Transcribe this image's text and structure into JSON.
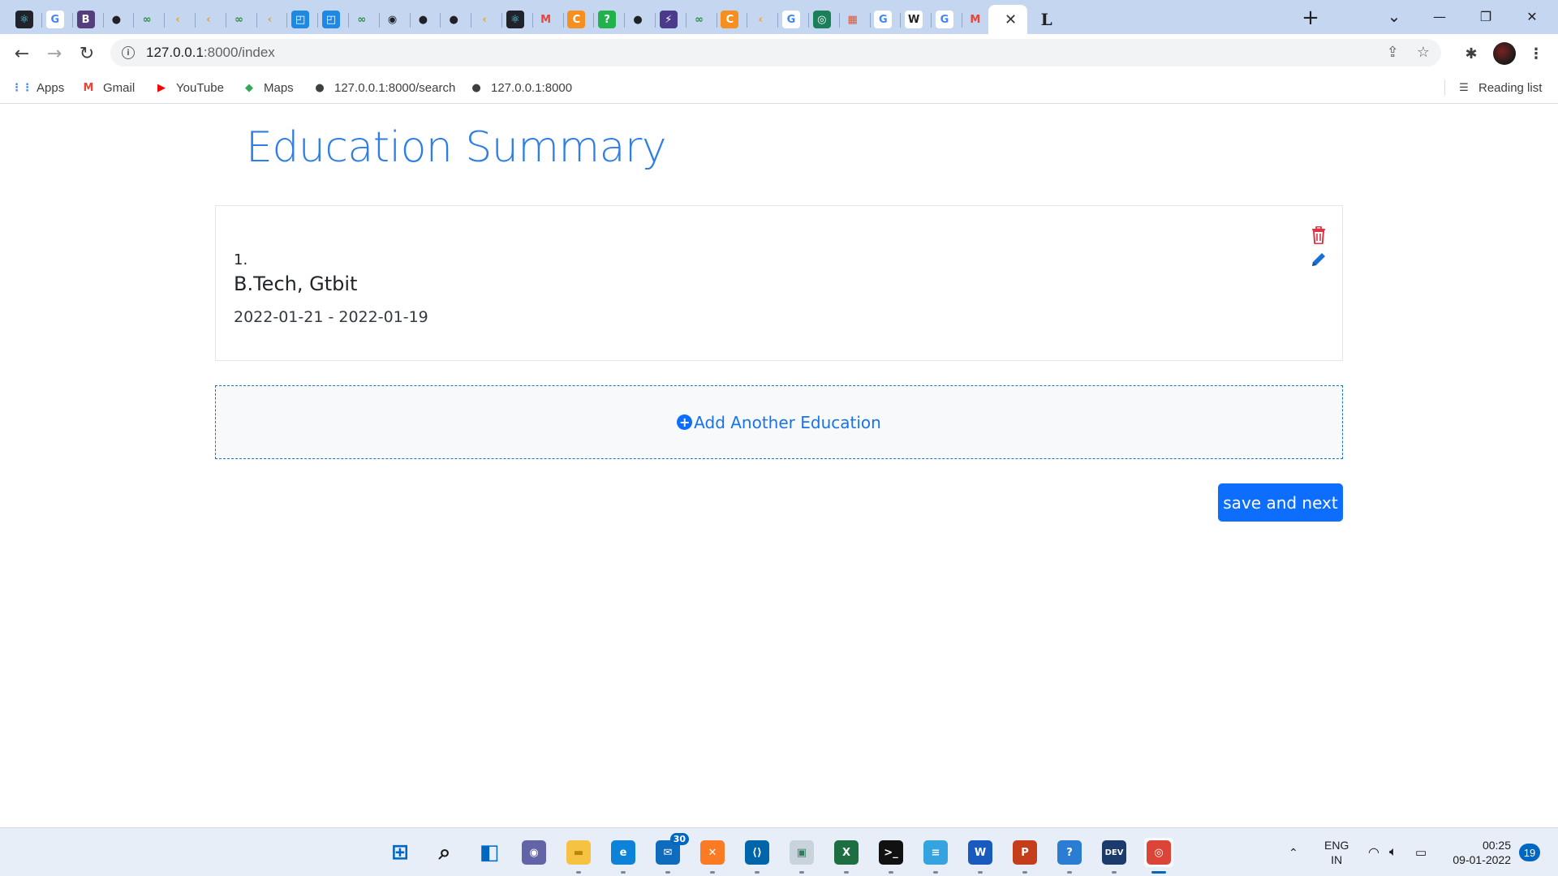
{
  "browser": {
    "tabs": [
      {
        "icon": "react-icon",
        "glyph": "⚛",
        "color": "#61dafb",
        "bg": "#20232a"
      },
      {
        "icon": "google-icon",
        "glyph": "G",
        "color": "#4285f4",
        "bg": "#ffffff"
      },
      {
        "icon": "bootstrap-icon",
        "glyph": "B",
        "color": "#ffffff",
        "bg": "#563d7c"
      },
      {
        "icon": "globe-icon",
        "glyph": "●",
        "color": "#202124",
        "bg": "#c5d6f0"
      },
      {
        "icon": "geeksforgeeks-icon",
        "glyph": "∞",
        "color": "#2f8d46",
        "bg": "#c5d6f0"
      },
      {
        "icon": "codepen-icon",
        "glyph": "‹",
        "color": "#f0a01a",
        "bg": "#c5d6f0"
      },
      {
        "icon": "codepen-icon",
        "glyph": "‹",
        "color": "#f0a01a",
        "bg": "#c5d6f0"
      },
      {
        "icon": "geeksforgeeks-icon",
        "glyph": "∞",
        "color": "#2f8d46",
        "bg": "#c5d6f0"
      },
      {
        "icon": "codepen-icon",
        "glyph": "‹",
        "color": "#f0a01a",
        "bg": "#c5d6f0"
      },
      {
        "icon": "vscode-doc-icon",
        "glyph": "◰",
        "color": "#ffffff",
        "bg": "#1e88e5"
      },
      {
        "icon": "vscode-doc-icon",
        "glyph": "◰",
        "color": "#ffffff",
        "bg": "#1e88e5"
      },
      {
        "icon": "geeksforgeeks-icon",
        "glyph": "∞",
        "color": "#2f8d46",
        "bg": "#c5d6f0"
      },
      {
        "icon": "github-icon",
        "glyph": "◉",
        "color": "#202124",
        "bg": "#c5d6f0"
      },
      {
        "icon": "globe-icon",
        "glyph": "●",
        "color": "#202124",
        "bg": "#c5d6f0"
      },
      {
        "icon": "globe-icon",
        "glyph": "●",
        "color": "#202124",
        "bg": "#c5d6f0"
      },
      {
        "icon": "codepen-icon",
        "glyph": "‹",
        "color": "#f0a01a",
        "bg": "#c5d6f0"
      },
      {
        "icon": "react-icon",
        "glyph": "⚛",
        "color": "#61dafb",
        "bg": "#20232a"
      },
      {
        "icon": "gmail-icon",
        "glyph": "M",
        "color": "#ea4335",
        "bg": "#c5d6f0"
      },
      {
        "icon": "codechef-icon",
        "glyph": "C",
        "color": "#ffffff",
        "bg": "#f78f1e"
      },
      {
        "icon": "question-green-icon",
        "glyph": "?",
        "color": "#ffffff",
        "bg": "#21b24b"
      },
      {
        "icon": "globe-icon",
        "glyph": "●",
        "color": "#202124",
        "bg": "#c5d6f0"
      },
      {
        "icon": "bolt-icon",
        "glyph": "⚡",
        "color": "#ffffff",
        "bg": "#4b3a8c"
      },
      {
        "icon": "geeksforgeeks-icon",
        "glyph": "∞",
        "color": "#2f8d46",
        "bg": "#c5d6f0"
      },
      {
        "icon": "codechef-icon",
        "glyph": "C",
        "color": "#ffffff",
        "bg": "#f78f1e"
      },
      {
        "icon": "codepen-icon",
        "glyph": "‹",
        "color": "#f0a01a",
        "bg": "#c5d6f0"
      },
      {
        "icon": "google-icon",
        "glyph": "G",
        "color": "#4285f4",
        "bg": "#ffffff"
      },
      {
        "icon": "app-green-icon",
        "glyph": "◎",
        "color": "#ffffff",
        "bg": "#1b7f5a"
      },
      {
        "icon": "microsoft-icon",
        "glyph": "▦",
        "color": "#f25022",
        "bg": "#c5d6f0"
      },
      {
        "icon": "google-icon",
        "glyph": "G",
        "color": "#4285f4",
        "bg": "#ffffff"
      },
      {
        "icon": "wikipedia-icon",
        "glyph": "W",
        "color": "#202124",
        "bg": "#ffffff"
      },
      {
        "icon": "google-icon",
        "glyph": "G",
        "color": "#4285f4",
        "bg": "#ffffff"
      },
      {
        "icon": "gmail-icon",
        "glyph": "M",
        "color": "#ea4335",
        "bg": "#c5d6f0"
      }
    ],
    "active_tab_close": "✕",
    "extra_tab": {
      "icon": "letter-l-icon",
      "glyph": "L"
    },
    "new_tab": "+",
    "window_controls": {
      "dropdown": "⌄",
      "minimize": "—",
      "restore": "❐",
      "close": "✕"
    },
    "address": {
      "host": "127.0.0.1",
      "path": ":8000/index"
    },
    "bookmarks": [
      {
        "label": "Apps",
        "icon": "apps-grid-icon",
        "glyph": "⋮⋮",
        "color": "#4285f4"
      },
      {
        "label": "Gmail",
        "icon": "gmail-icon",
        "glyph": "M",
        "color": "#ea4335"
      },
      {
        "label": "YouTube",
        "icon": "youtube-icon",
        "glyph": "▶",
        "color": "#ff0000"
      },
      {
        "label": "Maps",
        "icon": "maps-icon",
        "glyph": "◆",
        "color": "#34a853"
      },
      {
        "label": "127.0.0.1:8000/search",
        "icon": "globe-icon",
        "glyph": "●",
        "color": "#3c4043"
      },
      {
        "label": "127.0.0.1:8000",
        "icon": "globe-icon",
        "glyph": "●",
        "color": "#3c4043"
      }
    ],
    "reading_list": "Reading list"
  },
  "page": {
    "title": "Education Summary",
    "education": [
      {
        "number": "1.",
        "degree": "B.Tech, Gtbit",
        "dates": "2022-01-21 - 2022-01-19"
      }
    ],
    "add_label": "Add Another Education",
    "add_icon": "+",
    "save_label": "save and next",
    "colors": {
      "title": "#2f7ee6",
      "primary": "#0d6efd",
      "delete": "#dc3545",
      "edit": "#1a6fd6"
    }
  },
  "taskbar": {
    "apps": [
      {
        "name": "start-icon",
        "glyph": "⊞",
        "bg": "#e8eef8",
        "color": "#0067c0"
      },
      {
        "name": "search-icon",
        "glyph": "⌕",
        "bg": "#e8eef8",
        "color": "#1a1a1a"
      },
      {
        "name": "task-view-icon",
        "glyph": "◧",
        "bg": "#e8eef8",
        "color": "#0067c0"
      },
      {
        "name": "teams-chat-icon",
        "glyph": "◉",
        "bg": "#6264a7",
        "color": "#ffffff"
      },
      {
        "name": "file-explorer-icon",
        "glyph": "▬",
        "bg": "#f5c242",
        "color": "#b8860b"
      },
      {
        "name": "edge-icon",
        "glyph": "e",
        "bg": "#0c83d8",
        "color": "#ffffff"
      },
      {
        "name": "mail-icon",
        "glyph": "✉",
        "bg": "#0f6cbd",
        "color": "#ffffff",
        "badge": "30"
      },
      {
        "name": "xampp-icon",
        "glyph": "✕",
        "bg": "#fb7a24",
        "color": "#ffffff"
      },
      {
        "name": "vscode-icon",
        "glyph": "⟨⟩",
        "bg": "#0065a9",
        "color": "#ffffff"
      },
      {
        "name": "window-app-icon",
        "glyph": "▣",
        "bg": "#c8d3dc",
        "color": "#2f7d59"
      },
      {
        "name": "excel-icon",
        "glyph": "X",
        "bg": "#1d6f42",
        "color": "#ffffff"
      },
      {
        "name": "terminal-icon",
        "glyph": ">_",
        "bg": "#111111",
        "color": "#ffffff"
      },
      {
        "name": "notepad-icon",
        "glyph": "≡",
        "bg": "#35a3e0",
        "color": "#ffffff"
      },
      {
        "name": "word-icon",
        "glyph": "W",
        "bg": "#185abd",
        "color": "#ffffff"
      },
      {
        "name": "powerpoint-icon",
        "glyph": "P",
        "bg": "#c43e1c",
        "color": "#ffffff"
      },
      {
        "name": "help-icon",
        "glyph": "?",
        "bg": "#2b7cd3",
        "color": "#ffffff"
      },
      {
        "name": "devcpp-icon",
        "glyph": "DEV",
        "bg": "#1c3a6b",
        "color": "#ffffff"
      },
      {
        "name": "chrome-icon",
        "glyph": "◎",
        "bg": "#db4437",
        "color": "#ffffff"
      }
    ],
    "lang_top": "ENG",
    "lang_bottom": "IN",
    "time": "00:25",
    "date": "09-01-2022",
    "notifications": "19"
  }
}
